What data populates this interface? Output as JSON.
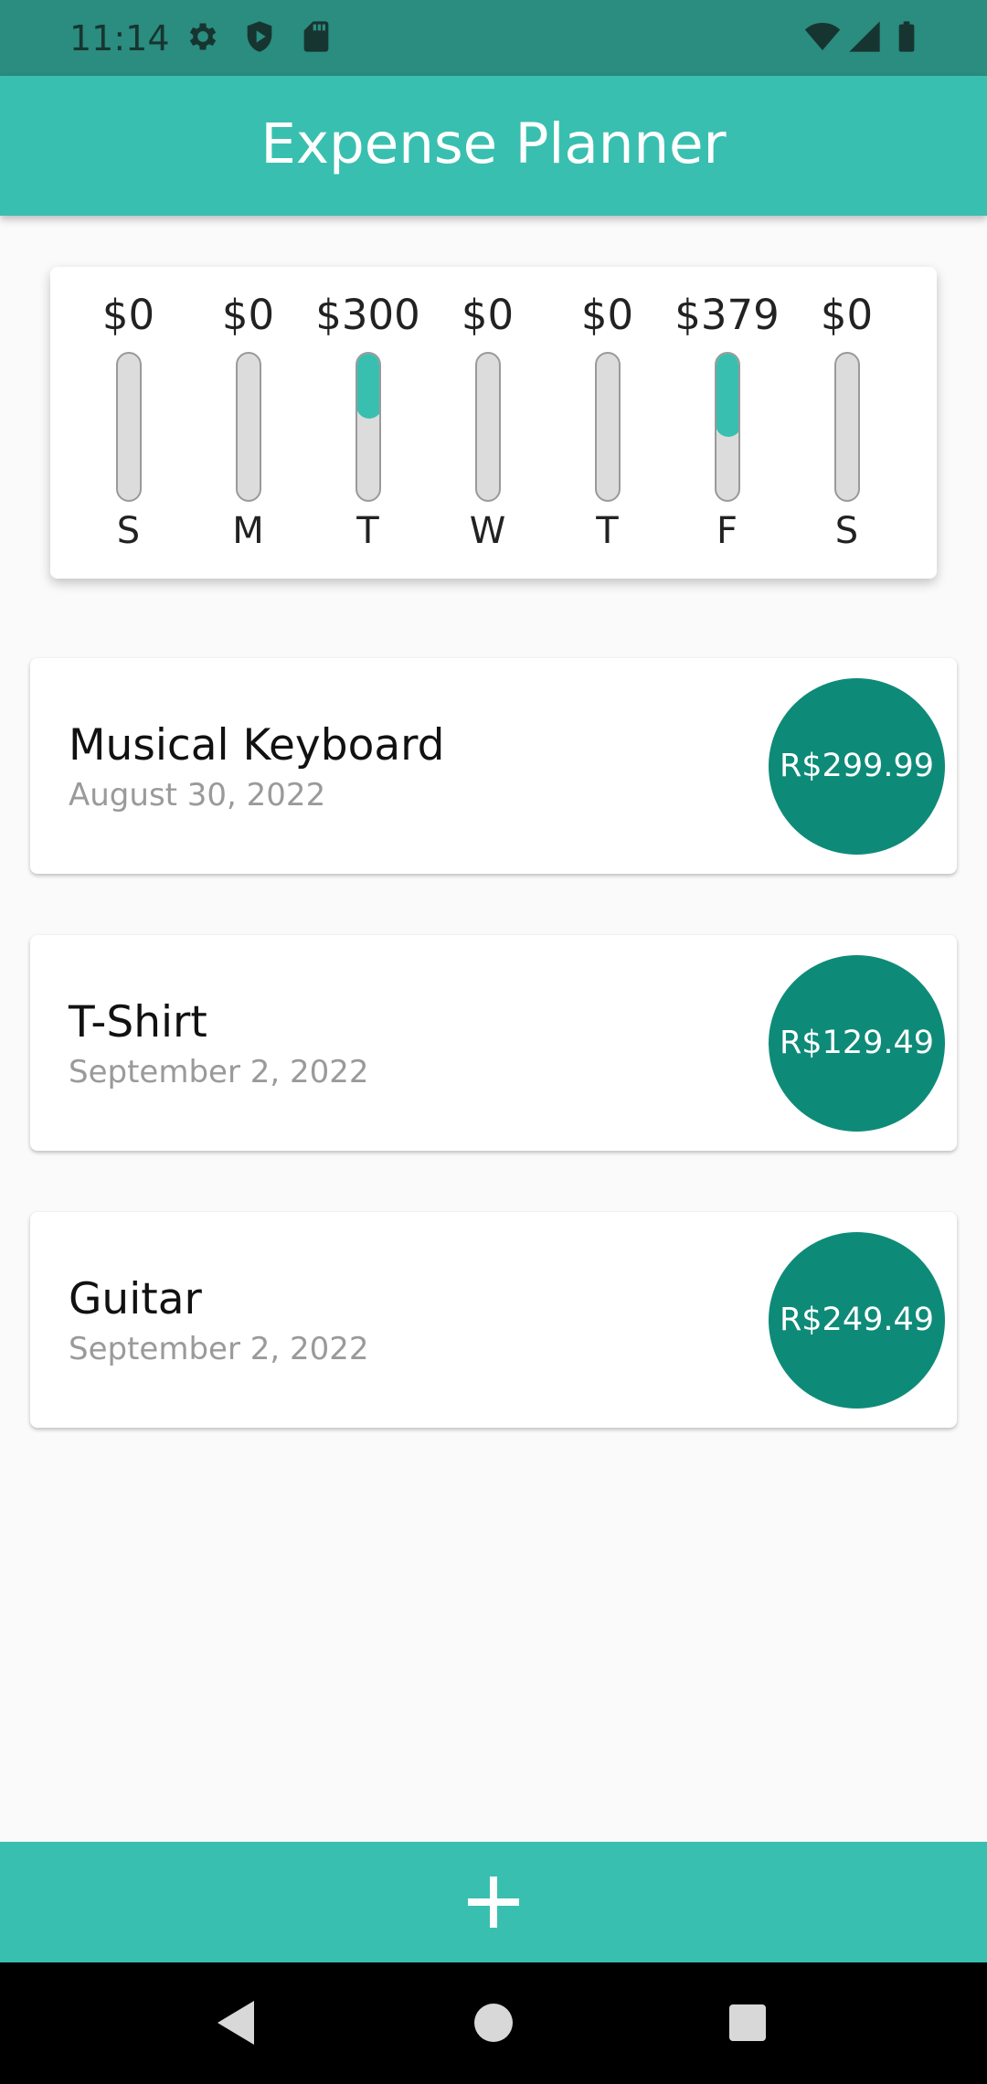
{
  "status_bar": {
    "time": "11:14",
    "icons": [
      "settings-icon",
      "shield-icon",
      "sd-card-icon",
      "wifi-icon",
      "signal-icon",
      "battery-icon"
    ]
  },
  "app_bar": {
    "title": "Expense Planner"
  },
  "weekly_chart": {
    "days": [
      {
        "label": "S",
        "amount": "$0",
        "fill": 0
      },
      {
        "label": "M",
        "amount": "$0",
        "fill": 0
      },
      {
        "label": "T",
        "amount": "$300",
        "fill": 0.44
      },
      {
        "label": "W",
        "amount": "$0",
        "fill": 0
      },
      {
        "label": "T",
        "amount": "$0",
        "fill": 0
      },
      {
        "label": "F",
        "amount": "$379",
        "fill": 0.56
      },
      {
        "label": "S",
        "amount": "$0",
        "fill": 0
      }
    ]
  },
  "transactions": [
    {
      "title": "Musical Keyboard",
      "date": "August 30, 2022",
      "amount": "R$299.99"
    },
    {
      "title": "T-Shirt",
      "date": "September 2, 2022",
      "amount": "R$129.49"
    },
    {
      "title": "Guitar",
      "date": "September 2, 2022",
      "amount": "R$249.49"
    }
  ],
  "bottom_bar": {
    "add_icon": "plus-icon"
  },
  "nav_bar": {
    "icons": [
      "back-icon",
      "home-icon",
      "recents-icon"
    ]
  },
  "colors": {
    "primary": "#39bfb0",
    "primary_dark": "#2b8c80",
    "accent": "#0e8b78"
  }
}
